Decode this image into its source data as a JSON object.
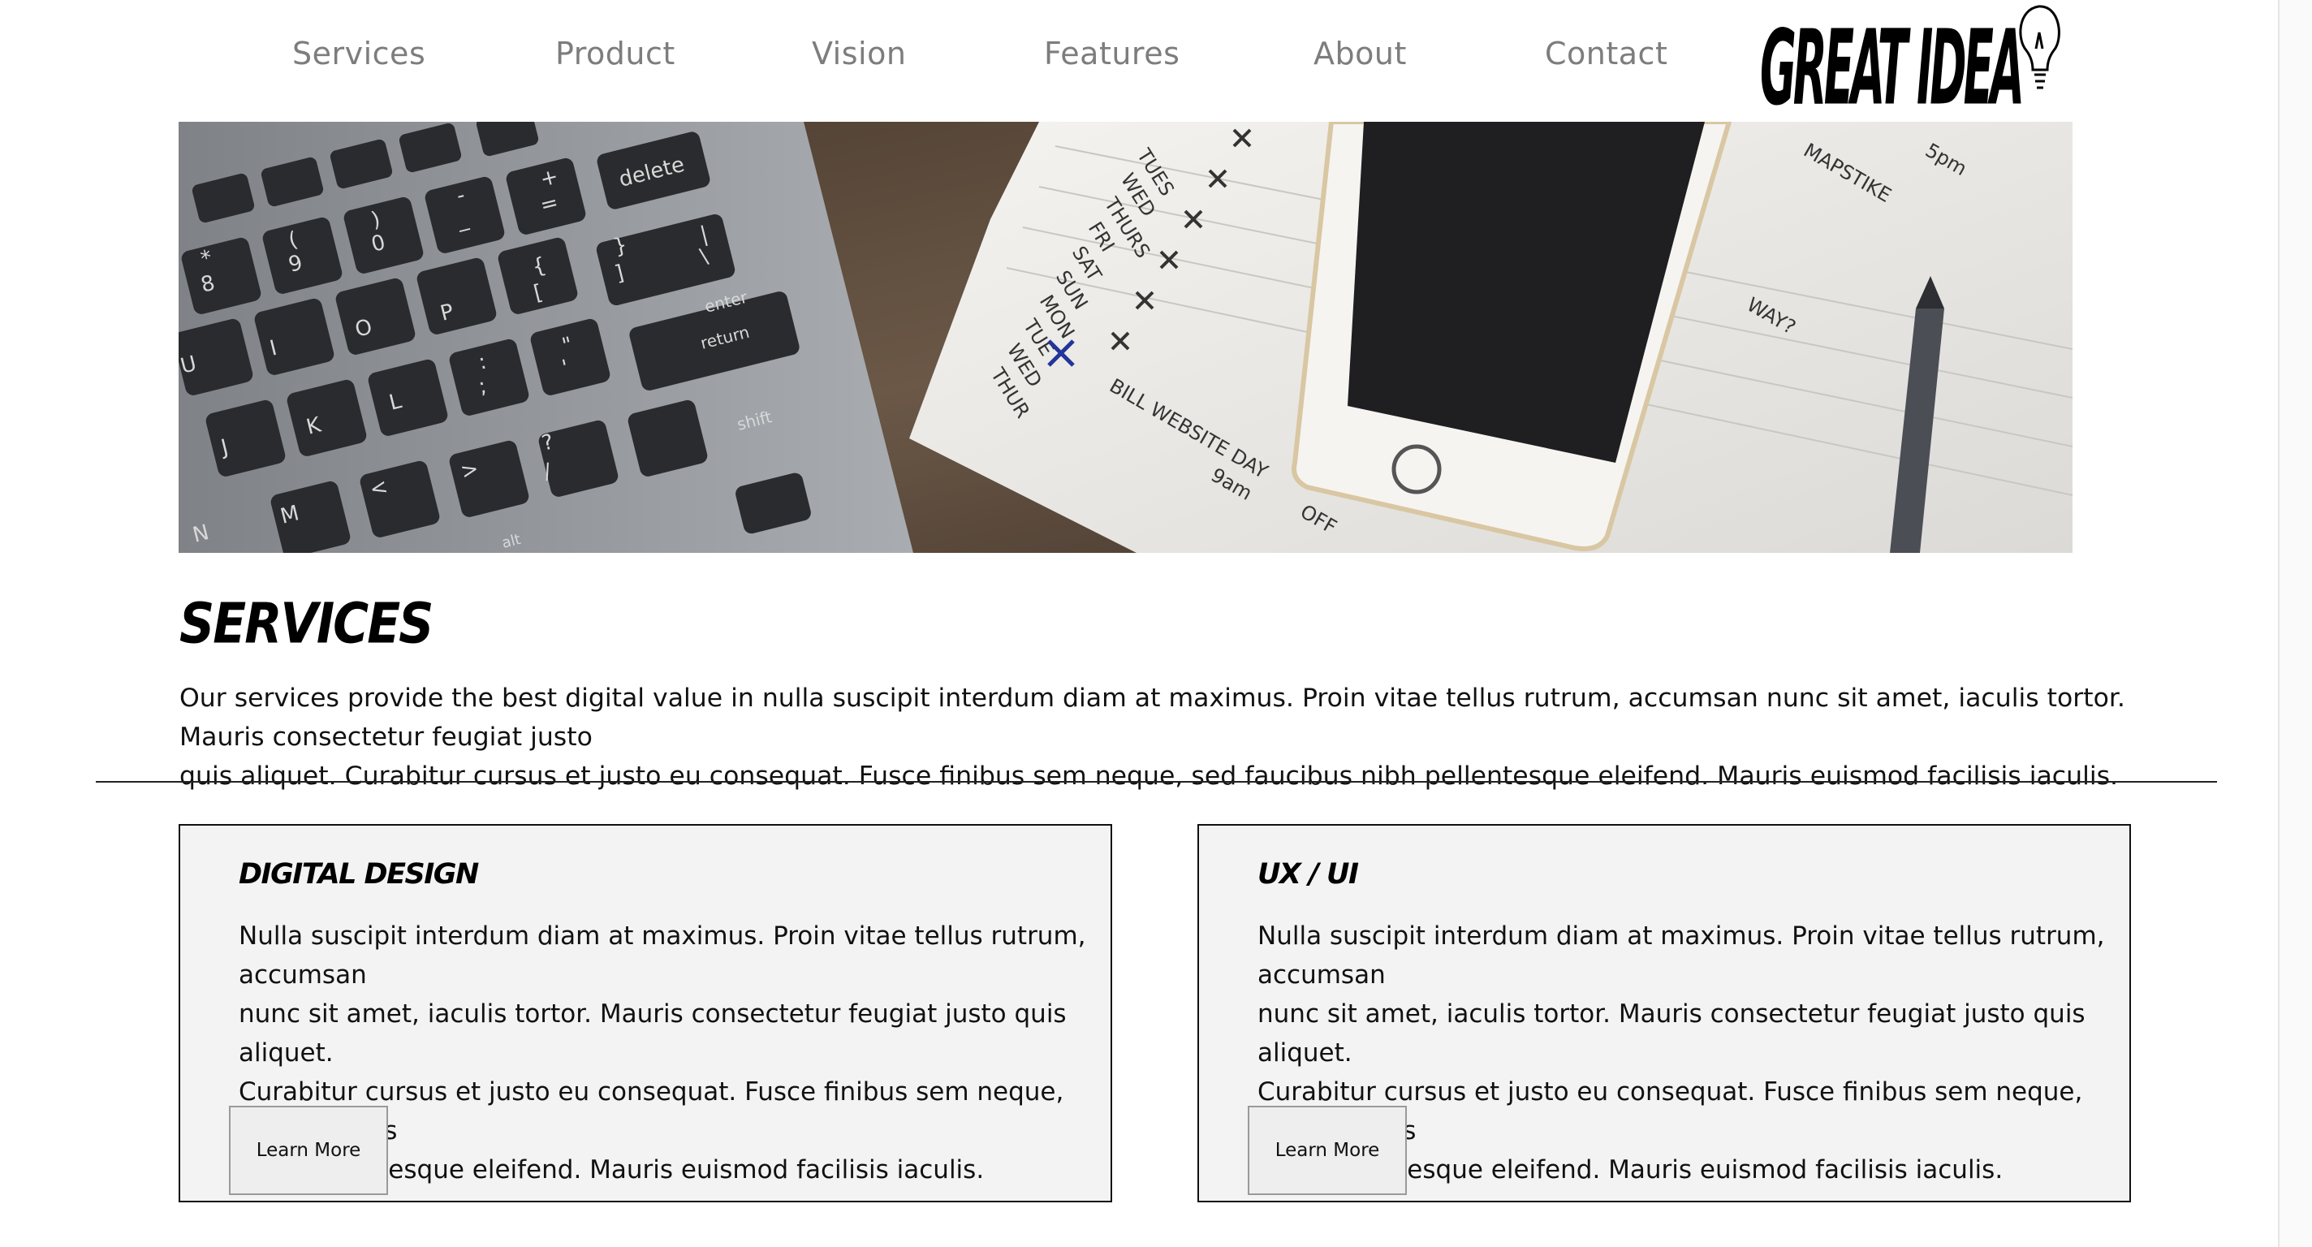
{
  "nav": {
    "items": [
      {
        "label": "Services"
      },
      {
        "label": "Product"
      },
      {
        "label": "Vision"
      },
      {
        "label": "Features"
      },
      {
        "label": "About"
      },
      {
        "label": "Contact"
      }
    ],
    "logo_text": "GREAT IDEA"
  },
  "hero": {
    "image": "laptop-notebook-phone-desk-photo",
    "notebook_notes": [
      "TUES",
      "WED",
      "THURS",
      "FRI",
      "SAT",
      "SUN",
      "MON",
      "TUE",
      "WED",
      "THUR",
      "BILL WEBSITE DAY",
      "9am",
      "OFF",
      "MAPSTIKE",
      "5pm",
      "WAY?"
    ],
    "key_labels": [
      "delete",
      "enter",
      "return",
      "shift",
      "alt",
      "+",
      "=",
      "8",
      "9",
      "0",
      "P",
      "O",
      "I",
      "U",
      "J",
      "K",
      "L",
      "N",
      "M",
      "<",
      ">",
      "?",
      "{",
      "}",
      "[",
      "]",
      "-",
      "_",
      "\"",
      "'",
      ":",
      ";",
      "*",
      "(",
      ")",
      "\\",
      "|",
      "/"
    ]
  },
  "services": {
    "title": "SERVICES",
    "intro_line1": "Our services provide the best digital value in nulla suscipit interdum diam at maximus. Proin vitae tellus rutrum, accumsan nunc sit amet, iaculis tortor. Mauris consectetur feugiat justo",
    "intro_line2": "quis aliquet. Curabitur cursus et justo eu consequat. Fusce finibus sem neque, sed faucibus nibh pellentesque eleifend. Mauris euismod facilisis iaculis."
  },
  "cards": [
    {
      "title": "DIGITAL DESIGN",
      "line1": "Nulla suscipit interdum diam at maximus. Proin vitae tellus rutrum, accumsan",
      "line2": "nunc sit amet, iaculis tortor. Mauris consectetur feugiat justo quis aliquet.",
      "line3": "Curabitur cursus et justo eu consequat. Fusce finibus sem neque, sed faucibus",
      "line4": "nibh pellentesque eleifend. Mauris euismod facilisis iaculis.",
      "button": "Learn More"
    },
    {
      "title": "UX / UI",
      "line1": "Nulla suscipit interdum diam at maximus. Proin vitae tellus rutrum, accumsan",
      "line2": "nunc sit amet, iaculis tortor. Mauris consectetur feugiat justo quis aliquet.",
      "line3": "Curabitur cursus et justo eu consequat. Fusce finibus sem neque, sed faucibus",
      "line4": "nibh pellentesque eleifend. Mauris euismod facilisis iaculis.",
      "button": "Learn More"
    }
  ],
  "colors": {
    "nav_text": "#7d7d7d",
    "card_bg": "#f3f3f3",
    "divider": "#222222"
  }
}
